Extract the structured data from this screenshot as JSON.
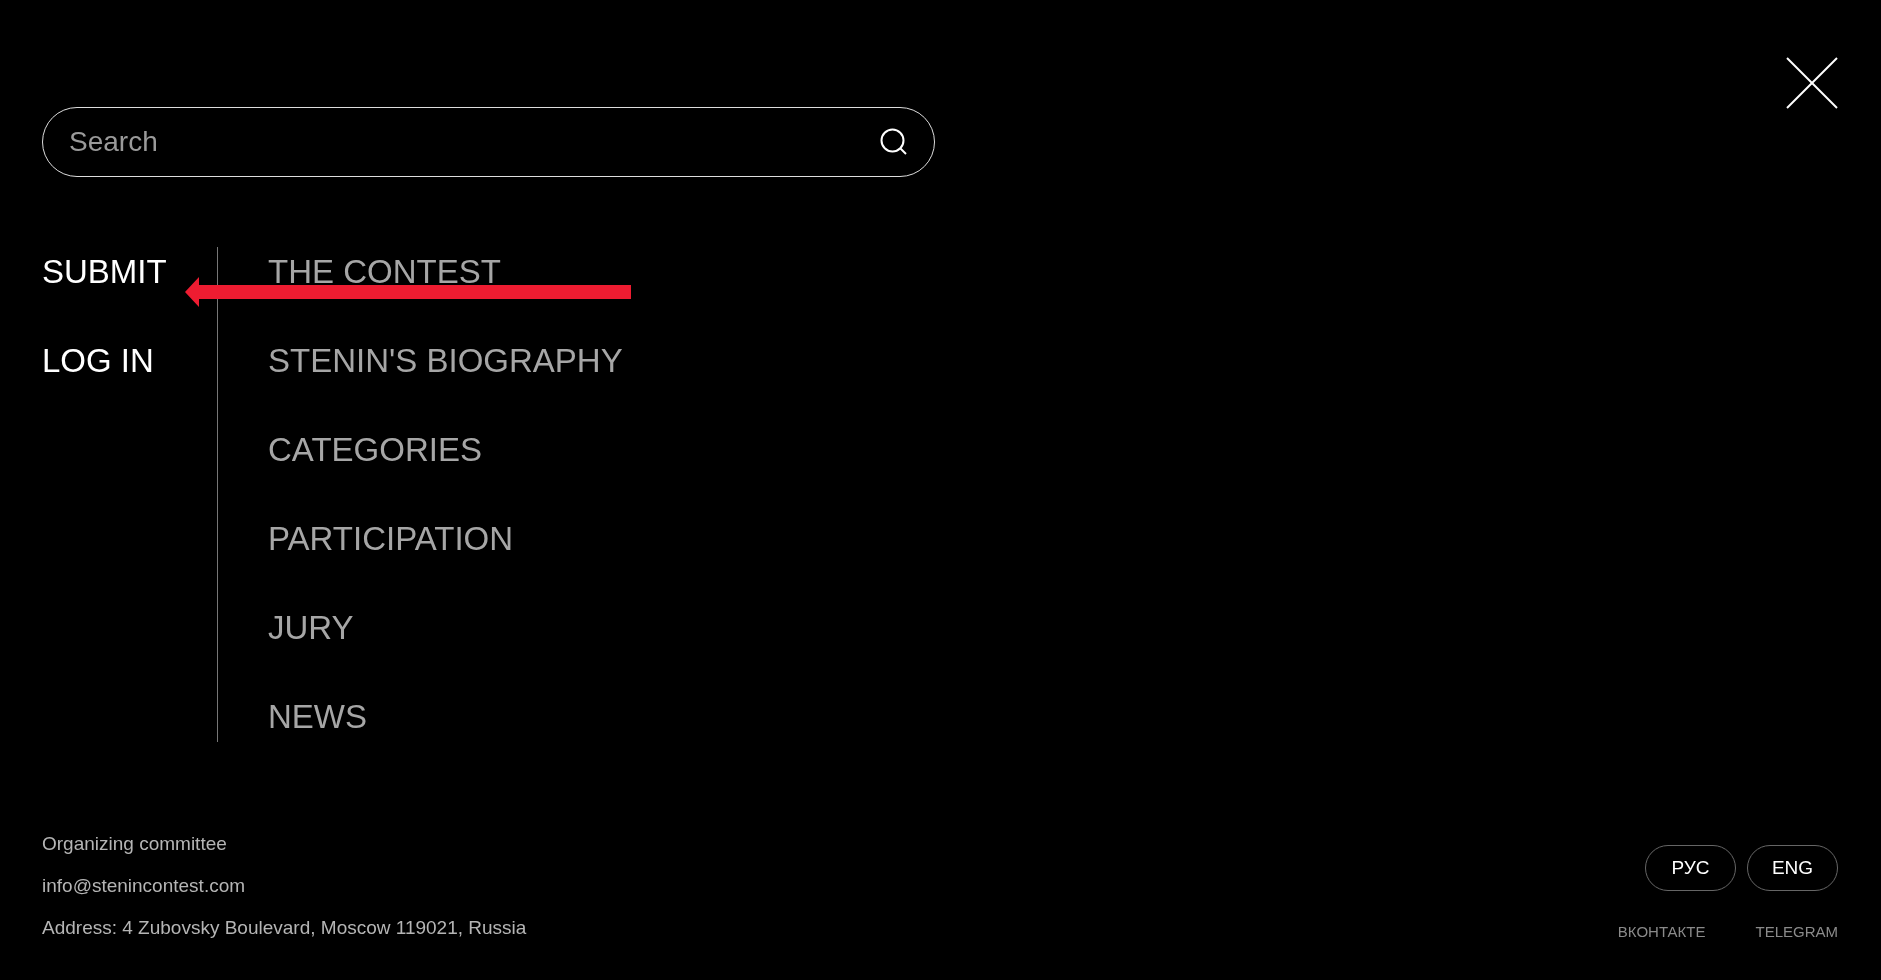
{
  "search": {
    "placeholder": "Search"
  },
  "account_links": [
    "SUBMIT",
    "LOG IN"
  ],
  "nav_items": [
    "THE CONTEST",
    "STENIN'S BIOGRAPHY",
    "CATEGORIES",
    "PARTICIPATION",
    "JURY",
    "NEWS"
  ],
  "footer": {
    "lines": [
      "Organizing committee",
      "info@stenincontest.com",
      "Address: 4 Zubovsky Boulevard, Moscow 119021, Russia"
    ],
    "languages": [
      "РУС",
      "ENG"
    ],
    "social_links": [
      "ВКОНТАКТЕ",
      "TELEGRAM"
    ]
  }
}
